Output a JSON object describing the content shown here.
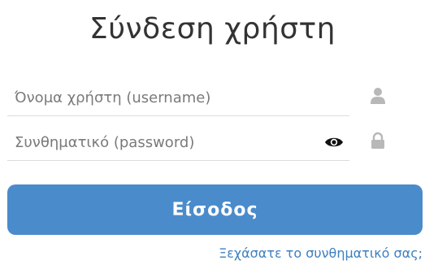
{
  "form": {
    "title": "Σύνδεση χρήστη",
    "username": {
      "placeholder": "Όνομα χρήστη (username)",
      "value": "",
      "icon": "user-icon"
    },
    "password": {
      "placeholder": "Συνθηματικό (password)",
      "value": "",
      "toggle_icon": "eye-icon",
      "icon": "lock-icon"
    },
    "submit_label": "Είσοδος",
    "forgot_link": "Ξεχάσατε το συνθηματικό σας;"
  },
  "colors": {
    "button": "#4a8bcb",
    "link": "#3d7fc1",
    "icon": "#b8b8b8",
    "title": "#333333"
  }
}
